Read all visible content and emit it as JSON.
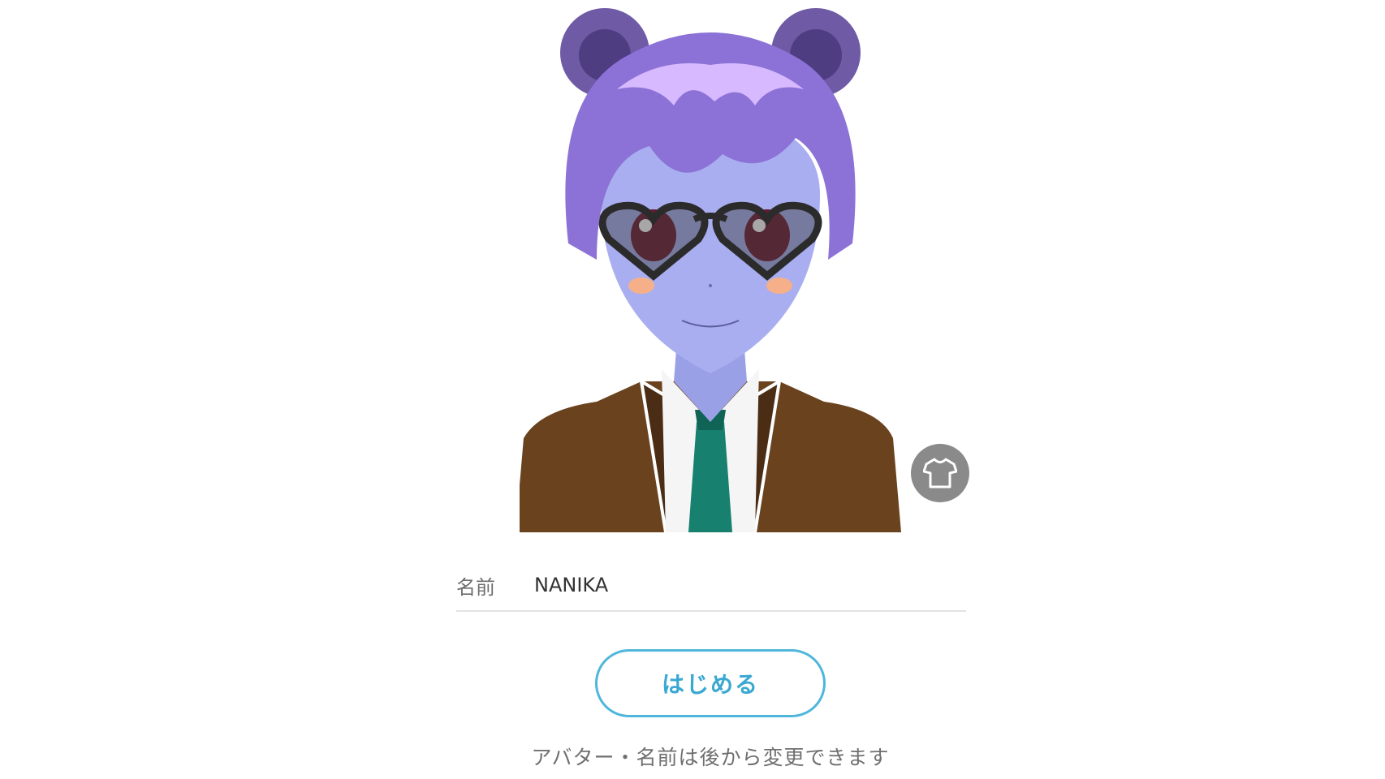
{
  "avatar": {
    "alt": "avatar preview",
    "colors": {
      "hair": "#8c72d6",
      "hair_highlight": "#d7b9ff",
      "skin": "#a8aef0",
      "jacket": "#6a421e",
      "tie": "#17806e"
    }
  },
  "outfit_button": {
    "icon": "shirt-icon",
    "color": "#8a8a8a"
  },
  "form": {
    "name_label": "名前",
    "name_value": "NANIKA"
  },
  "start_button": {
    "label": "はじめる",
    "color": "#4fb6dc"
  },
  "note": "アバター・名前は後から変更できます"
}
